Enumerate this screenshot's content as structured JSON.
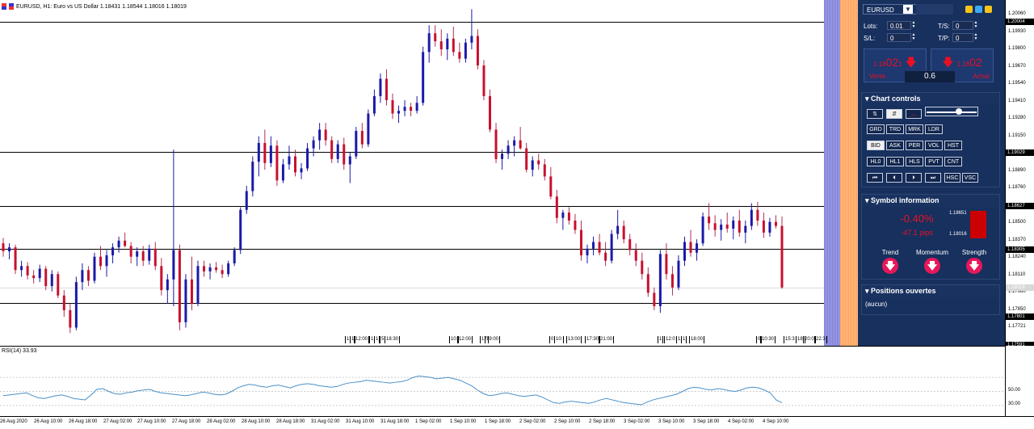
{
  "chart": {
    "title": "EURUSD, H1:  Euro vs US Dollar  1.18431 1.18544 1.18016 1.18019",
    "colors": {
      "bull": "#1a1aa8",
      "bear": "#c8102e",
      "wick": "#555555"
    },
    "price_ticks": [
      "1.20060",
      "1.19930",
      "1.19800",
      "1.19670",
      "1.19540",
      "1.19410",
      "1.19280",
      "1.19150",
      "1.18890",
      "1.18760",
      "1.18500",
      "1.18370",
      "1.18240",
      "1.18110",
      "1.17980",
      "1.17850",
      "1.17721"
    ],
    "price_labels": [
      {
        "value": "1.20004",
        "grey": false
      },
      {
        "value": "1.19029",
        "grey": false
      },
      {
        "value": "1.18627",
        "grey": false
      },
      {
        "value": "1.18305",
        "grey": false
      },
      {
        "value": "1.18019",
        "grey": true
      },
      {
        "value": "1.17801",
        "grey": false
      },
      {
        "value": "1.17591",
        "grey": false
      }
    ],
    "session_marks": [
      "1",
      "1",
      "12:00",
      "1",
      "1",
      "5",
      "18:30",
      "10:",
      "12:00",
      "17",
      "19:00",
      "0",
      "10:",
      "13:00",
      "17:30",
      "21:00",
      "1",
      "12:0",
      "1",
      "1",
      "18:00",
      "0",
      "10:30",
      "15:3",
      "18:",
      "20:0",
      "22:3"
    ],
    "candles": [
      [
        1.1835,
        1.1839,
        1.1825,
        1.1829
      ],
      [
        1.1829,
        1.1835,
        1.1823,
        1.1832
      ],
      [
        1.1832,
        1.1834,
        1.1812,
        1.1815
      ],
      [
        1.1815,
        1.1822,
        1.181,
        1.1818
      ],
      [
        1.1818,
        1.1821,
        1.1808,
        1.1811
      ],
      [
        1.1811,
        1.1815,
        1.1805,
        1.1809
      ],
      [
        1.1809,
        1.1819,
        1.1806,
        1.1816
      ],
      [
        1.1816,
        1.1818,
        1.18,
        1.1803
      ],
      [
        1.1803,
        1.1815,
        1.1799,
        1.1812
      ],
      [
        1.1812,
        1.1814,
        1.1794,
        1.1796
      ],
      [
        1.1796,
        1.18,
        1.178,
        1.1785
      ],
      [
        1.1785,
        1.179,
        1.1768,
        1.1772
      ],
      [
        1.1772,
        1.181,
        1.177,
        1.1806
      ],
      [
        1.1806,
        1.182,
        1.18,
        1.1815
      ],
      [
        1.1815,
        1.1818,
        1.1803,
        1.1807
      ],
      [
        1.1807,
        1.1828,
        1.1805,
        1.1825
      ],
      [
        1.1825,
        1.1833,
        1.1815,
        1.1818
      ],
      [
        1.1818,
        1.183,
        1.181,
        1.1826
      ],
      [
        1.1826,
        1.1835,
        1.182,
        1.1832
      ],
      [
        1.1832,
        1.184,
        1.1828,
        1.1837
      ],
      [
        1.1837,
        1.1843,
        1.1832,
        1.1833
      ],
      [
        1.1833,
        1.1836,
        1.182,
        1.1825
      ],
      [
        1.1825,
        1.1832,
        1.1818,
        1.1829
      ],
      [
        1.1829,
        1.1833,
        1.1818,
        1.1822
      ],
      [
        1.1822,
        1.1834,
        1.1819,
        1.1831
      ],
      [
        1.1831,
        1.1836,
        1.1815,
        1.1818
      ],
      [
        1.1818,
        1.1824,
        1.1796,
        1.18
      ],
      [
        1.18,
        1.1812,
        1.179,
        1.1808
      ],
      [
        1.1808,
        1.1905,
        1.1788,
        1.183
      ],
      [
        1.183,
        1.1834,
        1.177,
        1.1776
      ],
      [
        1.1776,
        1.1812,
        1.1772,
        1.1808
      ],
      [
        1.1808,
        1.1825,
        1.1785,
        1.179
      ],
      [
        1.179,
        1.1822,
        1.1788,
        1.1818
      ],
      [
        1.1818,
        1.1822,
        1.181,
        1.1814
      ],
      [
        1.1814,
        1.182,
        1.1808,
        1.1817
      ],
      [
        1.1817,
        1.1821,
        1.1813,
        1.1815
      ],
      [
        1.1815,
        1.1819,
        1.1809,
        1.1812
      ],
      [
        1.1812,
        1.1822,
        1.181,
        1.182
      ],
      [
        1.182,
        1.1832,
        1.1818,
        1.183
      ],
      [
        1.183,
        1.1862,
        1.1827,
        1.186
      ],
      [
        1.186,
        1.1878,
        1.1857,
        1.1874
      ],
      [
        1.1874,
        1.19,
        1.187,
        1.1896
      ],
      [
        1.1896,
        1.1915,
        1.1885,
        1.191
      ],
      [
        1.191,
        1.192,
        1.189,
        1.1895
      ],
      [
        1.1895,
        1.1915,
        1.1892,
        1.1908
      ],
      [
        1.1908,
        1.1912,
        1.1878,
        1.1882
      ],
      [
        1.1882,
        1.1898,
        1.188,
        1.1894
      ],
      [
        1.1894,
        1.1908,
        1.189,
        1.19
      ],
      [
        1.19,
        1.1905,
        1.1885,
        1.1888
      ],
      [
        1.1888,
        1.1895,
        1.1883,
        1.1891
      ],
      [
        1.1891,
        1.191,
        1.1889,
        1.1906
      ],
      [
        1.1906,
        1.1915,
        1.19,
        1.1912
      ],
      [
        1.1912,
        1.1925,
        1.1905,
        1.192
      ],
      [
        1.192,
        1.1925,
        1.1908,
        1.1912
      ],
      [
        1.1912,
        1.1915,
        1.1895,
        1.1898
      ],
      [
        1.1898,
        1.1912,
        1.1895,
        1.1909
      ],
      [
        1.1909,
        1.1914,
        1.189,
        1.1894
      ],
      [
        1.1894,
        1.1903,
        1.188,
        1.19
      ],
      [
        1.19,
        1.1922,
        1.1898,
        1.1919
      ],
      [
        1.1919,
        1.1925,
        1.1906,
        1.1909
      ],
      [
        1.1909,
        1.1935,
        1.1907,
        1.1932
      ],
      [
        1.1932,
        1.195,
        1.193,
        1.1945
      ],
      [
        1.1945,
        1.1962,
        1.194,
        1.1958
      ],
      [
        1.1958,
        1.1965,
        1.1938,
        1.1942
      ],
      [
        1.1942,
        1.1947,
        1.1928,
        1.1932
      ],
      [
        1.1932,
        1.1938,
        1.1925,
        1.1934
      ],
      [
        1.1934,
        1.1942,
        1.193,
        1.1937
      ],
      [
        1.1937,
        1.194,
        1.193,
        1.1934
      ],
      [
        1.1934,
        1.1945,
        1.1932,
        1.194
      ],
      [
        1.194,
        1.1982,
        1.1938,
        1.1978
      ],
      [
        1.1978,
        1.1998,
        1.197,
        1.1992
      ],
      [
        1.1992,
        1.1998,
        1.1982,
        1.1986
      ],
      [
        1.1986,
        1.1995,
        1.1975,
        1.198
      ],
      [
        1.198,
        1.1992,
        1.1972,
        1.1988
      ],
      [
        1.1988,
        1.1997,
        1.1975,
        1.1978
      ],
      [
        1.1978,
        1.1985,
        1.197,
        1.1973
      ],
      [
        1.1973,
        1.1988,
        1.197,
        1.1985
      ],
      [
        1.1985,
        1.201,
        1.198,
        1.199
      ],
      [
        1.199,
        1.1995,
        1.1965,
        1.1968
      ],
      [
        1.1968,
        1.1972,
        1.1942,
        1.1945
      ],
      [
        1.1945,
        1.195,
        1.1918,
        1.192
      ],
      [
        1.192,
        1.1925,
        1.1895,
        1.1898
      ],
      [
        1.1898,
        1.1905,
        1.189,
        1.1902
      ],
      [
        1.1902,
        1.1912,
        1.1898,
        1.1908
      ],
      [
        1.1908,
        1.1915,
        1.19,
        1.1912
      ],
      [
        1.1912,
        1.1922,
        1.1905,
        1.1906
      ],
      [
        1.1906,
        1.191,
        1.1888,
        1.189
      ],
      [
        1.189,
        1.19,
        1.1885,
        1.1897
      ],
      [
        1.1897,
        1.1902,
        1.189,
        1.1894
      ],
      [
        1.1894,
        1.1898,
        1.1882,
        1.1885
      ],
      [
        1.1885,
        1.1892,
        1.1868,
        1.187
      ],
      [
        1.187,
        1.1875,
        1.185,
        1.1854
      ],
      [
        1.1854,
        1.186,
        1.1845,
        1.1858
      ],
      [
        1.1858,
        1.1862,
        1.1849,
        1.1852
      ],
      [
        1.1852,
        1.1857,
        1.1842,
        1.1845
      ],
      [
        1.1845,
        1.1852,
        1.1822,
        1.1826
      ],
      [
        1.1826,
        1.1834,
        1.182,
        1.1831
      ],
      [
        1.1831,
        1.184,
        1.1826,
        1.1836
      ],
      [
        1.1836,
        1.1842,
        1.1826,
        1.1828
      ],
      [
        1.1828,
        1.1836,
        1.1818,
        1.1822
      ],
      [
        1.1822,
        1.1845,
        1.182,
        1.1842
      ],
      [
        1.1842,
        1.186,
        1.1838,
        1.1848
      ],
      [
        1.1848,
        1.1852,
        1.1835,
        1.1838
      ],
      [
        1.1838,
        1.1842,
        1.1826,
        1.183
      ],
      [
        1.183,
        1.1835,
        1.1818,
        1.1822
      ],
      [
        1.1822,
        1.1828,
        1.1808,
        1.1812
      ],
      [
        1.1812,
        1.1817,
        1.1795,
        1.1798
      ],
      [
        1.1798,
        1.1802,
        1.1785,
        1.1788
      ],
      [
        1.1788,
        1.183,
        1.1783,
        1.1827
      ],
      [
        1.1827,
        1.1835,
        1.1808,
        1.1812
      ],
      [
        1.1812,
        1.1818,
        1.1796,
        1.1802
      ],
      [
        1.1802,
        1.1826,
        1.18,
        1.1822
      ],
      [
        1.1822,
        1.184,
        1.1818,
        1.1836
      ],
      [
        1.1836,
        1.1845,
        1.1825,
        1.1828
      ],
      [
        1.1828,
        1.1838,
        1.1822,
        1.1835
      ],
      [
        1.1835,
        1.1858,
        1.1833,
        1.1855
      ],
      [
        1.1855,
        1.1865,
        1.1845,
        1.185
      ],
      [
        1.185,
        1.1856,
        1.184,
        1.1845
      ],
      [
        1.1845,
        1.1853,
        1.1837,
        1.1849
      ],
      [
        1.1849,
        1.1858,
        1.1843,
        1.1846
      ],
      [
        1.1846,
        1.1855,
        1.1838,
        1.1852
      ],
      [
        1.1852,
        1.186,
        1.184,
        1.1843
      ],
      [
        1.1843,
        1.1852,
        1.1835,
        1.1848
      ],
      [
        1.1848,
        1.1865,
        1.1845,
        1.186
      ],
      [
        1.186,
        1.1866,
        1.1848,
        1.1852
      ],
      [
        1.1852,
        1.1858,
        1.1839,
        1.1843
      ],
      [
        1.1843,
        1.1854,
        1.184,
        1.1851
      ],
      [
        1.1851,
        1.1856,
        1.1846,
        1.1848
      ],
      [
        1.1848,
        1.1855,
        1.1801,
        1.1802
      ]
    ],
    "current_price": "1.18019"
  },
  "panel": {
    "symbol": "EURUSD",
    "lots_label": "Lots:",
    "lots_value": "0.01",
    "ts_label": "T/S:",
    "ts_value": "0",
    "sl_label": "S/L:",
    "sl_value": "0",
    "tp_label": "T/P:",
    "tp_value": "0",
    "sell": {
      "prefix": "1.18",
      "big": "02",
      "sup": "1",
      "label": "Vente"
    },
    "buy": {
      "prefix": "1.18",
      "big": "02",
      "sup": "",
      "label": "Achat"
    },
    "spread_value": "0.6",
    "chart_controls_title": "Chart controls",
    "row1": [
      "GRD",
      "TRD",
      "MRK",
      "LDR"
    ],
    "row2": [
      "BID",
      "ASK",
      "PER",
      "VOL",
      "HST"
    ],
    "row3": [
      "HL0",
      "HL1",
      "HLS",
      "PVT",
      "CNT"
    ],
    "row4": [
      "⏮",
      "⏴",
      "⏵",
      "⏭",
      "HSC",
      "VSC"
    ],
    "symbol_info_title": "Symbol information",
    "change_pct": "-0.40%",
    "change_pips": "-47.1 pips",
    "high": "1.18651",
    "low": "1.18016",
    "trend_label": "Trend",
    "momentum_label": "Momentum",
    "strength_label": "Strength",
    "positions_title": "Positions ouvertes",
    "positions_empty": "(aucun)"
  },
  "rsi": {
    "label": "RSI(14) 33.93",
    "ticks": [
      "50.00",
      "30.00"
    ],
    "line_color": "#4a90c8",
    "values": [
      44,
      45,
      46,
      47,
      48,
      44,
      41,
      40,
      42,
      44,
      45,
      43,
      40,
      39,
      38,
      45,
      53,
      54,
      50,
      47,
      46,
      48,
      49,
      51,
      52,
      53,
      50,
      48,
      47,
      46,
      45,
      44,
      45,
      47,
      49,
      48,
      46,
      45,
      46,
      50,
      55,
      58,
      60,
      59,
      57,
      56,
      58,
      59,
      57,
      55,
      58,
      60,
      61,
      60,
      58,
      57,
      56,
      57,
      60,
      62,
      63,
      64,
      66,
      65,
      64,
      63,
      62,
      63,
      64,
      66,
      70,
      72,
      71,
      70,
      68,
      69,
      70,
      68,
      66,
      62,
      58,
      52,
      47,
      44,
      45,
      47,
      48,
      46,
      44,
      43,
      44,
      45,
      42,
      38,
      34,
      33,
      35,
      36,
      35,
      34,
      33,
      35,
      38,
      40,
      38,
      36,
      34,
      33,
      32,
      31,
      35,
      38,
      40,
      42,
      44,
      46,
      50,
      54,
      56,
      55,
      53,
      52,
      54,
      53,
      51,
      50,
      52,
      55,
      56,
      55,
      52,
      48,
      38,
      33.93
    ]
  },
  "time_axis": [
    "26 Aug 2020",
    "26 Aug 10:00",
    "26 Aug 18:00",
    "27 Aug 02:00",
    "27 Aug 10:00",
    "27 Aug 18:00",
    "28 Aug 02:00",
    "28 Aug 10:00",
    "28 Aug 18:00",
    "31 Aug 02:00",
    "31 Aug 10:00",
    "31 Aug 18:00",
    "1 Sep 02:00",
    "1 Sep 10:00",
    "1 Sep 18:00",
    "2 Sep 02:00",
    "2 Sep 10:00",
    "2 Sep 18:00",
    "3 Sep 02:00",
    "3 Sep 10:00",
    "3 Sep 18:00",
    "4 Sep 02:00",
    "4 Sep 10:00"
  ]
}
